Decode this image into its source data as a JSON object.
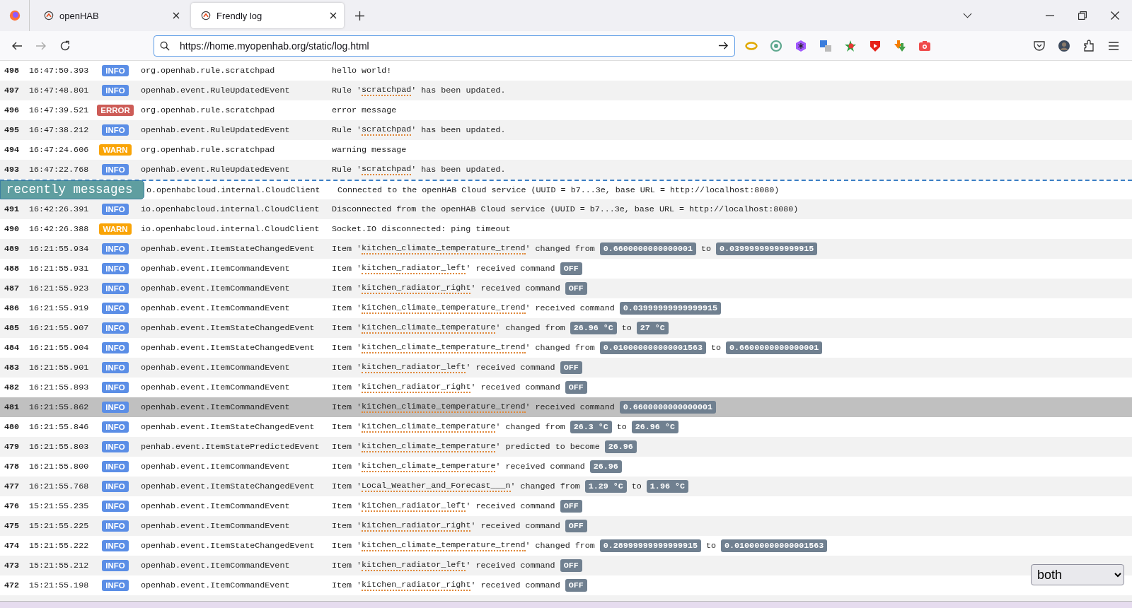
{
  "browser": {
    "tabs": [
      {
        "title": "openHAB",
        "selected": false
      },
      {
        "title": "Frendly log",
        "selected": true
      }
    ],
    "address": {
      "value": "https://home.myopenhab.org/static/log.html"
    }
  },
  "log": {
    "rows": [
      {
        "number": "498",
        "time": "16:47:50.393",
        "level": {
          "text": "INFO",
          "color": "#5b8ee6"
        },
        "source": "org.openhab.rule.scratchpad",
        "selected": false,
        "parts": [
          {
            "kind": "text",
            "text": "hello world!"
          }
        ]
      },
      {
        "number": "497",
        "time": "16:47:48.801",
        "level": {
          "text": "INFO",
          "color": "#5b8ee6"
        },
        "source": "openhab.event.RuleUpdatedEvent",
        "selected": false,
        "parts": [
          {
            "kind": "text",
            "text": "Rule '"
          },
          {
            "kind": "item",
            "text": "scratchpad"
          },
          {
            "kind": "text",
            "text": "' has been updated."
          }
        ]
      },
      {
        "number": "496",
        "time": "16:47:39.521",
        "level": {
          "text": "ERROR",
          "color": "#cd5c57"
        },
        "source": "org.openhab.rule.scratchpad",
        "selected": false,
        "parts": [
          {
            "kind": "text",
            "text": "error message"
          }
        ]
      },
      {
        "number": "495",
        "time": "16:47:38.212",
        "level": {
          "text": "INFO",
          "color": "#5b8ee6"
        },
        "source": "openhab.event.RuleUpdatedEvent",
        "selected": false,
        "parts": [
          {
            "kind": "text",
            "text": "Rule '"
          },
          {
            "kind": "item",
            "text": "scratchpad"
          },
          {
            "kind": "text",
            "text": "' has been updated."
          }
        ]
      },
      {
        "number": "494",
        "time": "16:47:24.606",
        "level": {
          "text": "WARN",
          "color": "#f9a406"
        },
        "source": "org.openhab.rule.scratchpad",
        "selected": false,
        "parts": [
          {
            "kind": "text",
            "text": "warning message"
          }
        ]
      },
      {
        "number": "493",
        "time": "16:47:22.768",
        "level": {
          "text": "INFO",
          "color": "#5b8ee6"
        },
        "source": "openhab.event.RuleUpdatedEvent",
        "selected": false,
        "parts": [
          {
            "kind": "text",
            "text": "Rule '"
          },
          {
            "kind": "item",
            "text": "scratchpad"
          },
          {
            "kind": "text",
            "text": "' has been updated."
          }
        ]
      },
      {
        "marker": "recently messages",
        "source": "o.openhabcloud.internal.CloudClient",
        "selected": false,
        "parts": [
          {
            "kind": "text",
            "text": "Connected to the openHAB Cloud service (UUID = b7...3e, base URL = http://localhost:8080)"
          }
        ]
      },
      {
        "number": "491",
        "time": "16:42:26.391",
        "level": {
          "text": "INFO",
          "color": "#5b8ee6"
        },
        "source": "io.openhabcloud.internal.CloudClient",
        "selected": false,
        "parts": [
          {
            "kind": "text",
            "text": "Disconnected from the openHAB Cloud service (UUID = b7...3e, base URL = http://localhost:8080)"
          }
        ]
      },
      {
        "number": "490",
        "time": "16:42:26.388",
        "level": {
          "text": "WARN",
          "color": "#f9a406"
        },
        "source": "io.openhabcloud.internal.CloudClient",
        "selected": false,
        "parts": [
          {
            "kind": "text",
            "text": "Socket.IO disconnected: ping timeout"
          }
        ]
      },
      {
        "number": "489",
        "time": "16:21:55.934",
        "level": {
          "text": "INFO",
          "color": "#5b8ee6"
        },
        "source": "openhab.event.ItemStateChangedEvent",
        "selected": false,
        "parts": [
          {
            "kind": "text",
            "text": "Item '"
          },
          {
            "kind": "item",
            "text": "kitchen_climate_temperature_trend"
          },
          {
            "kind": "text",
            "text": "' changed from"
          },
          {
            "kind": "value",
            "text": "0.6600000000000001"
          },
          {
            "kind": "text",
            "text": "to"
          },
          {
            "kind": "value",
            "text": "0.03999999999999915"
          }
        ]
      },
      {
        "number": "488",
        "time": "16:21:55.931",
        "level": {
          "text": "INFO",
          "color": "#5b8ee6"
        },
        "source": "openhab.event.ItemCommandEvent",
        "selected": false,
        "parts": [
          {
            "kind": "text",
            "text": "Item '"
          },
          {
            "kind": "item",
            "text": "kitchen_radiator_left"
          },
          {
            "kind": "text",
            "text": "' received command"
          },
          {
            "kind": "value",
            "text": "OFF"
          }
        ]
      },
      {
        "number": "487",
        "time": "16:21:55.923",
        "level": {
          "text": "INFO",
          "color": "#5b8ee6"
        },
        "source": "openhab.event.ItemCommandEvent",
        "selected": false,
        "parts": [
          {
            "kind": "text",
            "text": "Item '"
          },
          {
            "kind": "item",
            "text": "kitchen_radiator_right"
          },
          {
            "kind": "text",
            "text": "' received command"
          },
          {
            "kind": "value",
            "text": "OFF"
          }
        ]
      },
      {
        "number": "486",
        "time": "16:21:55.919",
        "level": {
          "text": "INFO",
          "color": "#5b8ee6"
        },
        "source": "openhab.event.ItemCommandEvent",
        "selected": false,
        "parts": [
          {
            "kind": "text",
            "text": "Item '"
          },
          {
            "kind": "item",
            "text": "kitchen_climate_temperature_trend"
          },
          {
            "kind": "text",
            "text": "' received command"
          },
          {
            "kind": "value",
            "text": "0.03999999999999915"
          }
        ]
      },
      {
        "number": "485",
        "time": "16:21:55.907",
        "level": {
          "text": "INFO",
          "color": "#5b8ee6"
        },
        "source": "openhab.event.ItemStateChangedEvent",
        "selected": false,
        "parts": [
          {
            "kind": "text",
            "text": "Item '"
          },
          {
            "kind": "item",
            "text": "kitchen_climate_temperature"
          },
          {
            "kind": "text",
            "text": "' changed from"
          },
          {
            "kind": "value",
            "text": "26.96 °C"
          },
          {
            "kind": "text",
            "text": "to"
          },
          {
            "kind": "value",
            "text": "27 °C"
          }
        ]
      },
      {
        "number": "484",
        "time": "16:21:55.904",
        "level": {
          "text": "INFO",
          "color": "#5b8ee6"
        },
        "source": "openhab.event.ItemStateChangedEvent",
        "selected": false,
        "parts": [
          {
            "kind": "text",
            "text": "Item '"
          },
          {
            "kind": "item",
            "text": "kitchen_climate_temperature_trend"
          },
          {
            "kind": "text",
            "text": "' changed from"
          },
          {
            "kind": "value",
            "text": "0.010000000000001563"
          },
          {
            "kind": "text",
            "text": "to"
          },
          {
            "kind": "value",
            "text": "0.6600000000000001"
          }
        ]
      },
      {
        "number": "483",
        "time": "16:21:55.901",
        "level": {
          "text": "INFO",
          "color": "#5b8ee6"
        },
        "source": "openhab.event.ItemCommandEvent",
        "selected": false,
        "parts": [
          {
            "kind": "text",
            "text": "Item '"
          },
          {
            "kind": "item",
            "text": "kitchen_radiator_left"
          },
          {
            "kind": "text",
            "text": "' received command"
          },
          {
            "kind": "value",
            "text": "OFF"
          }
        ]
      },
      {
        "number": "482",
        "time": "16:21:55.893",
        "level": {
          "text": "INFO",
          "color": "#5b8ee6"
        },
        "source": "openhab.event.ItemCommandEvent",
        "selected": false,
        "parts": [
          {
            "kind": "text",
            "text": "Item '"
          },
          {
            "kind": "item",
            "text": "kitchen_radiator_right"
          },
          {
            "kind": "text",
            "text": "' received command"
          },
          {
            "kind": "value",
            "text": "OFF"
          }
        ]
      },
      {
        "number": "481",
        "time": "16:21:55.862",
        "level": {
          "text": "INFO",
          "color": "#5b8ee6"
        },
        "source": "openhab.event.ItemCommandEvent",
        "selected": true,
        "parts": [
          {
            "kind": "text",
            "text": "Item '"
          },
          {
            "kind": "item",
            "text": "kitchen_climate_temperature_trend"
          },
          {
            "kind": "text",
            "text": "' received command"
          },
          {
            "kind": "value",
            "text": "0.6600000000000001"
          }
        ]
      },
      {
        "number": "480",
        "time": "16:21:55.846",
        "level": {
          "text": "INFO",
          "color": "#5b8ee6"
        },
        "source": "openhab.event.ItemStateChangedEvent",
        "selected": false,
        "parts": [
          {
            "kind": "text",
            "text": "Item '"
          },
          {
            "kind": "item",
            "text": "kitchen_climate_temperature"
          },
          {
            "kind": "text",
            "text": "' changed from"
          },
          {
            "kind": "value",
            "text": "26.3 °C"
          },
          {
            "kind": "text",
            "text": "to"
          },
          {
            "kind": "value",
            "text": "26.96 °C"
          }
        ]
      },
      {
        "number": "479",
        "time": "16:21:55.803",
        "level": {
          "text": "INFO",
          "color": "#5b8ee6"
        },
        "source": "penhab.event.ItemStatePredictedEvent",
        "selected": false,
        "parts": [
          {
            "kind": "text",
            "text": "Item '"
          },
          {
            "kind": "item",
            "text": "kitchen_climate_temperature"
          },
          {
            "kind": "text",
            "text": "' predicted to become"
          },
          {
            "kind": "value",
            "text": "26.96"
          }
        ]
      },
      {
        "number": "478",
        "time": "16:21:55.800",
        "level": {
          "text": "INFO",
          "color": "#5b8ee6"
        },
        "source": "openhab.event.ItemCommandEvent",
        "selected": false,
        "parts": [
          {
            "kind": "text",
            "text": "Item '"
          },
          {
            "kind": "item",
            "text": "kitchen_climate_temperature"
          },
          {
            "kind": "text",
            "text": "' received command"
          },
          {
            "kind": "value",
            "text": "26.96"
          }
        ]
      },
      {
        "number": "477",
        "time": "16:21:55.768",
        "level": {
          "text": "INFO",
          "color": "#5b8ee6"
        },
        "source": "openhab.event.ItemStateChangedEvent",
        "selected": false,
        "parts": [
          {
            "kind": "text",
            "text": "Item '"
          },
          {
            "kind": "item",
            "text": "Local_Weather_and_Forecast___n"
          },
          {
            "kind": "text",
            "text": "' changed from"
          },
          {
            "kind": "value",
            "text": "1.29 °C"
          },
          {
            "kind": "text",
            "text": "to"
          },
          {
            "kind": "value",
            "text": "1.96 °C"
          }
        ]
      },
      {
        "number": "476",
        "time": "15:21:55.235",
        "level": {
          "text": "INFO",
          "color": "#5b8ee6"
        },
        "source": "openhab.event.ItemCommandEvent",
        "selected": false,
        "parts": [
          {
            "kind": "text",
            "text": "Item '"
          },
          {
            "kind": "item",
            "text": "kitchen_radiator_left"
          },
          {
            "kind": "text",
            "text": "' received command"
          },
          {
            "kind": "value",
            "text": "OFF"
          }
        ]
      },
      {
        "number": "475",
        "time": "15:21:55.225",
        "level": {
          "text": "INFO",
          "color": "#5b8ee6"
        },
        "source": "openhab.event.ItemCommandEvent",
        "selected": false,
        "parts": [
          {
            "kind": "text",
            "text": "Item '"
          },
          {
            "kind": "item",
            "text": "kitchen_radiator_right"
          },
          {
            "kind": "text",
            "text": "' received command"
          },
          {
            "kind": "value",
            "text": "OFF"
          }
        ]
      },
      {
        "number": "474",
        "time": "15:21:55.222",
        "level": {
          "text": "INFO",
          "color": "#5b8ee6"
        },
        "source": "openhab.event.ItemStateChangedEvent",
        "selected": false,
        "parts": [
          {
            "kind": "text",
            "text": "Item '"
          },
          {
            "kind": "item",
            "text": "kitchen_climate_temperature_trend"
          },
          {
            "kind": "text",
            "text": "' changed from"
          },
          {
            "kind": "value",
            "text": "0.28999999999999915"
          },
          {
            "kind": "text",
            "text": "to"
          },
          {
            "kind": "value",
            "text": "0.010000000000001563"
          }
        ]
      },
      {
        "number": "473",
        "time": "15:21:55.212",
        "level": {
          "text": "INFO",
          "color": "#5b8ee6"
        },
        "source": "openhab.event.ItemCommandEvent",
        "selected": false,
        "parts": [
          {
            "kind": "text",
            "text": "Item '"
          },
          {
            "kind": "item",
            "text": "kitchen_radiator_left"
          },
          {
            "kind": "text",
            "text": "' received command"
          },
          {
            "kind": "value",
            "text": "OFF"
          }
        ]
      },
      {
        "number": "472",
        "time": "15:21:55.198",
        "level": {
          "text": "INFO",
          "color": "#5b8ee6"
        },
        "source": "openhab.event.ItemCommandEvent",
        "selected": false,
        "parts": [
          {
            "kind": "text",
            "text": "Item '"
          },
          {
            "kind": "item",
            "text": "kitchen_radiator_right"
          },
          {
            "kind": "text",
            "text": "' received command"
          },
          {
            "kind": "value",
            "text": "OFF"
          }
        ]
      }
    ]
  },
  "filter": {
    "value": "both"
  }
}
